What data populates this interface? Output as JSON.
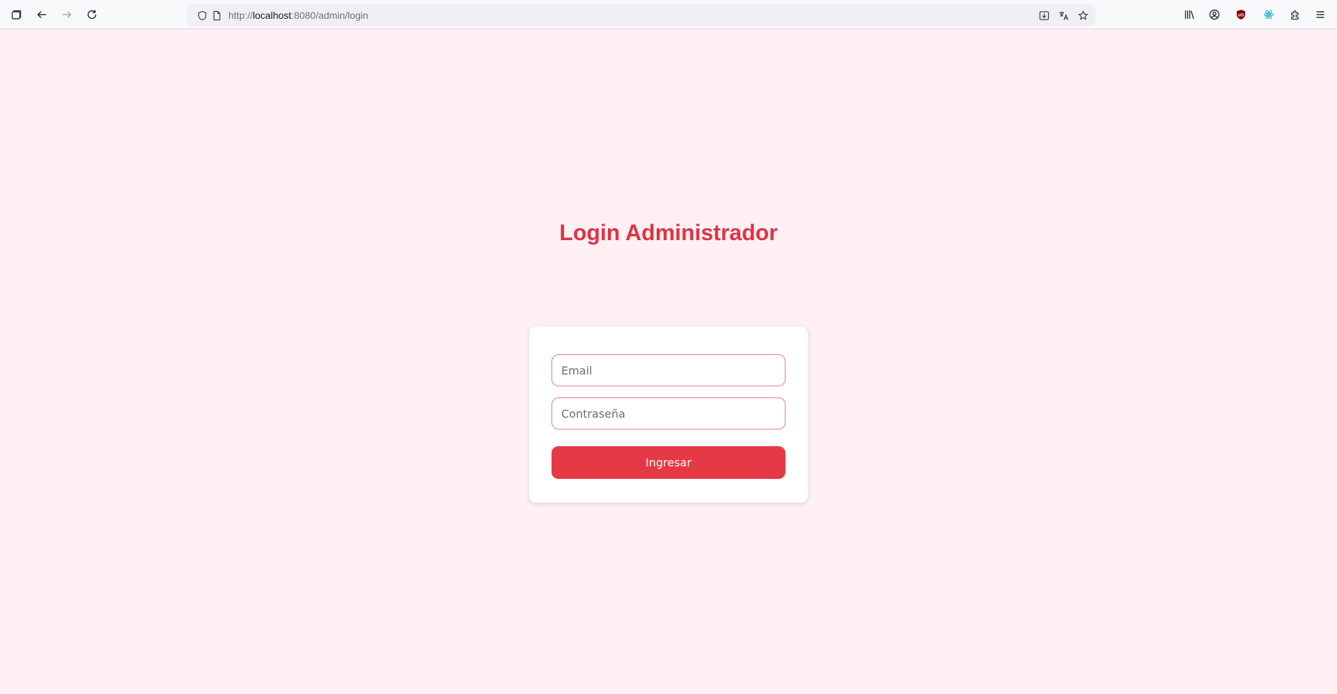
{
  "browser": {
    "url_prefix": "http://",
    "url_host": "localhost",
    "url_rest": ":8080/admin/login"
  },
  "page": {
    "title": "Login Administrador",
    "email_placeholder": "Email",
    "password_placeholder": "Contraseña",
    "submit_label": "Ingresar"
  },
  "colors": {
    "page_background": "#fff0f3",
    "accent": "#dc3545",
    "button": "#e63946",
    "field_border": "#e3798a"
  }
}
